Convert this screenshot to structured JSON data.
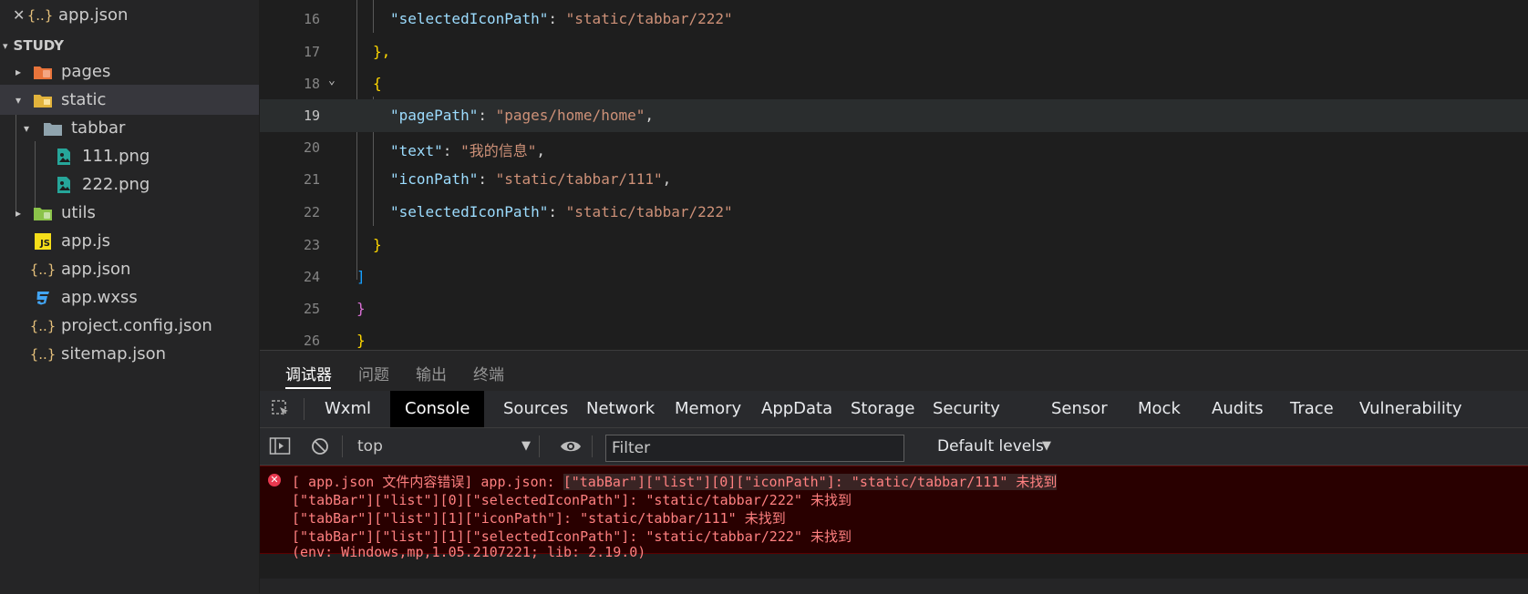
{
  "sidebar": {
    "open_file": {
      "close_glyph": "✕",
      "icon": "{..}",
      "name": "app.json"
    },
    "section": "STUDY",
    "tree": [
      {
        "label": "pages",
        "icon": "folder-pages-icon",
        "arrow": "▸"
      },
      {
        "label": "static",
        "icon": "folder-static-icon",
        "arrow": "▾"
      },
      {
        "label": "tabbar",
        "icon": "folder-icon",
        "arrow": "▾"
      },
      {
        "label": "111.png",
        "icon": "image-file-icon"
      },
      {
        "label": "222.png",
        "icon": "image-file-icon"
      },
      {
        "label": "utils",
        "icon": "folder-utils-icon",
        "arrow": "▸"
      },
      {
        "label": "app.js",
        "icon": "js-file-icon",
        "badge": "JS"
      },
      {
        "label": "app.json",
        "icon": "json-file-icon",
        "badge": "{..}"
      },
      {
        "label": "app.wxss",
        "icon": "css-file-icon"
      },
      {
        "label": "project.config.json",
        "icon": "json-file-icon",
        "badge": "{..}"
      },
      {
        "label": "sitemap.json",
        "icon": "json-file-icon",
        "badge": "{..}"
      }
    ]
  },
  "editor": {
    "lines": [
      {
        "num": "16",
        "key": "\"selectedIconPath\"",
        "colon": ": ",
        "value": "\"static/tabbar/222\"",
        "tail": ""
      },
      {
        "num": "17",
        "brace": "},",
        "brace_class": "b1"
      },
      {
        "num": "18",
        "brace": "{",
        "brace_class": "b1",
        "fold": "⌄"
      },
      {
        "num": "19",
        "key": "\"pagePath\"",
        "colon": ": ",
        "value": "\"pages/home/home\"",
        "tail": ","
      },
      {
        "num": "20",
        "key": "\"text\"",
        "colon": ": ",
        "value": "\"我的信息\"",
        "tail": ","
      },
      {
        "num": "21",
        "key": "\"iconPath\"",
        "colon": ": ",
        "value": "\"static/tabbar/111\"",
        "tail": ","
      },
      {
        "num": "22",
        "key": "\"selectedIconPath\"",
        "colon": ": ",
        "value": "\"static/tabbar/222\"",
        "tail": ""
      },
      {
        "num": "23",
        "brace": "}",
        "brace_class": "b1"
      },
      {
        "num": "24",
        "brace": "]",
        "brace_class": "b3"
      },
      {
        "num": "25",
        "brace": "}",
        "brace_class": "b2"
      },
      {
        "num": "26",
        "brace": "}",
        "brace_class": "b1"
      }
    ]
  },
  "panel": {
    "tabs": [
      "调试器",
      "问题",
      "输出",
      "终端"
    ],
    "devtools_tabs": [
      "Wxml",
      "Console",
      "Sources",
      "Network",
      "Memory",
      "AppData",
      "Storage",
      "Security",
      "Sensor",
      "Mock",
      "Audits",
      "Trace",
      "Vulnerability"
    ],
    "toolbar": {
      "context": "top",
      "context_arrow": "▼",
      "filter_placeholder": "Filter",
      "levels": "Default levels",
      "levels_arrow": "▼"
    },
    "errors": {
      "prefix": "[ app.json 文件内容错误] app.json: ",
      "first": "[\"tabBar\"][\"list\"][0][\"iconPath\"]: \"static/tabbar/111\" 未找到",
      "lines": [
        "[\"tabBar\"][\"list\"][0][\"selectedIconPath\"]: \"static/tabbar/222\" 未找到",
        "[\"tabBar\"][\"list\"][1][\"iconPath\"]: \"static/tabbar/111\" 未找到",
        "[\"tabBar\"][\"list\"][1][\"selectedIconPath\"]: \"static/tabbar/222\" 未找到",
        "(env: Windows,mp,1.05.2107221; lib: 2.19.0)"
      ]
    }
  }
}
